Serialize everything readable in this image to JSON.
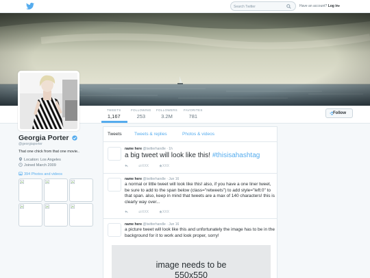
{
  "nav": {
    "search_placeholder": "Search Twitter",
    "account_prompt": "Have an account?",
    "login_label": "Log in",
    "login_caret": "▾"
  },
  "profile": {
    "name": "Georgia Porter",
    "handle": "@georgiaporter",
    "bio": "That one chick from that one movie..",
    "location": "Location: Los Angeles",
    "joined": "Joined March 2009",
    "photos_link": "394 Photos and videos",
    "follow_label": "Follow"
  },
  "stats": [
    {
      "label": "TWEETS",
      "value": "1,167"
    },
    {
      "label": "FOLLOWING",
      "value": "253"
    },
    {
      "label": "FOLLOWERS",
      "value": "3.2M"
    },
    {
      "label": "FAVORITES",
      "value": "781"
    }
  ],
  "tabs": [
    {
      "label": "Tweets"
    },
    {
      "label": "Tweets & replies"
    },
    {
      "label": "Photos & videos"
    }
  ],
  "tweets": [
    {
      "name": "name here",
      "meta": "@twitterhandle · 1h",
      "text": "a big tweet will look like this! ",
      "hashtag": "#thisisahashtag",
      "retweets": "XXX",
      "favorites": "XXX"
    },
    {
      "name": "name here",
      "meta": "@twitterhandle · Jun 16",
      "text": "a normal or little tweet will look like this! also, if you have a one liner tweet, be sure to add to the span below (class=\"retweets\") to add style=\"left:0\" to that span. also, keep in mind that tweets are a max of 140 characters! this is clearly way over...",
      "retweets": "XXX",
      "favorites": "XXX"
    },
    {
      "name": "name here",
      "meta": "@twitterhandle · Jun 16",
      "text": "a picture tweet will look like this and unfortunately the image has to be in the background for it to work and look proper, sorry!",
      "image_text_1": "image needs to be",
      "image_text_2": "550x550"
    }
  ],
  "colors": {
    "accent": "#55acee",
    "text": "#292f33",
    "muted": "#8899a6",
    "border": "#e1e8ed",
    "page_bg": "#f5f8fa"
  },
  "icons": [
    "twitter-bird-icon",
    "search-icon",
    "verified-badge-icon",
    "location-pin-icon",
    "calendar-icon",
    "photo-icon",
    "follow-icon",
    "reply-icon",
    "retweet-icon",
    "favorite-icon",
    "broken-image-icon"
  ]
}
